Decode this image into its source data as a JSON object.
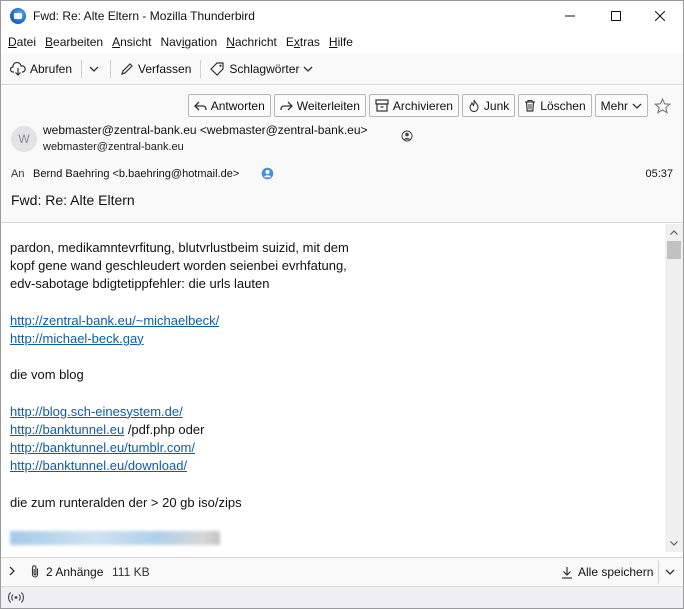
{
  "window": {
    "title": "Fwd: Re: Alte Eltern - Mozilla Thunderbird"
  },
  "menubar": {
    "items": [
      "Datei",
      "Bearbeiten",
      "Ansicht",
      "Navigation",
      "Nachricht",
      "Extras",
      "Hilfe"
    ]
  },
  "toolbar": {
    "get_messages": "Abrufen",
    "write": "Verfassen",
    "tags": "Schlagwörter"
  },
  "header_actions": {
    "reply": "Antworten",
    "forward": "Weiterleiten",
    "archive": "Archivieren",
    "junk": "Junk",
    "delete": "Löschen",
    "more": "Mehr"
  },
  "message": {
    "avatar_letter": "W",
    "from": "webmaster@zentral-bank.eu <webmaster@zentral-bank.eu>",
    "from_secondary": "webmaster@zentral-bank.eu",
    "to_label": "An",
    "to": "Bernd Baehring <b.baehring@hotmail.de>",
    "time": "05:37",
    "subject": "Fwd: Re: Alte Eltern"
  },
  "body": {
    "l1": "pardon, medikamntevrfitung, blutvrlustbeim suizid, mit dem",
    "l2": "kopf gene wand geschleudert worden seienbei evrhfatung,",
    "l3": "edv-sabotage bdigtetippfehler: die urls lauten",
    "link1": "http://zentral-bank.eu/~michaelbeck/",
    "link2": "http://michael-beck.gay",
    "l4": "die vom blog",
    "link3": "http://blog.sch-einesystem.de/",
    "link4": "http://banktunnel.eu",
    "link4_suffix": " /pdf.php oder",
    "link5": "http://banktunnel.eu/tumblr.com/",
    "link6": "http://banktunnel.eu/download/",
    "l5": "die zum runteralden der > 20 gb iso/zips"
  },
  "attachments": {
    "count": "2 Anhänge",
    "size": "111 KB",
    "save_all": "Alle speichern"
  },
  "colors": {
    "link": "#0a5ea8",
    "toolbar_bg": "#f9f9fa"
  }
}
